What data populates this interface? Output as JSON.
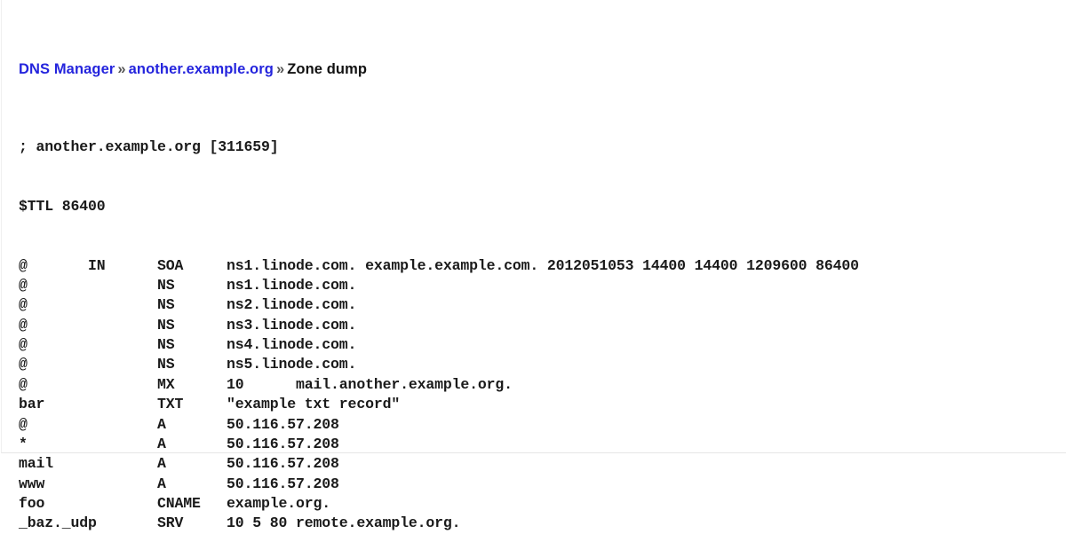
{
  "breadcrumb": {
    "root_label": "DNS Manager",
    "separator": "»",
    "zone_label": "another.example.org",
    "current_label": "Zone dump",
    "link_color": "#2424dd",
    "current_color": "#111111"
  },
  "zone_dump": {
    "comment_line": "; another.example.org [311659]",
    "ttl_line": "$TTL 86400",
    "zone_name": "another.example.org",
    "zone_id": "311659",
    "ttl": "86400",
    "columns": {
      "name": 8,
      "class": 8,
      "type": 8
    },
    "records": [
      {
        "name": "@",
        "class": "IN",
        "type": "SOA",
        "value": "ns1.linode.com. example.example.com. 2012051053 14400 14400 1209600 86400",
        "line": "@       IN      SOA     ns1.linode.com. example.example.com. 2012051053 14400 14400 1209600 86400"
      },
      {
        "name": "@",
        "class": "",
        "type": "NS",
        "value": "ns1.linode.com.",
        "line": "@               NS      ns1.linode.com."
      },
      {
        "name": "@",
        "class": "",
        "type": "NS",
        "value": "ns2.linode.com.",
        "line": "@               NS      ns2.linode.com."
      },
      {
        "name": "@",
        "class": "",
        "type": "NS",
        "value": "ns3.linode.com.",
        "line": "@               NS      ns3.linode.com."
      },
      {
        "name": "@",
        "class": "",
        "type": "NS",
        "value": "ns4.linode.com.",
        "line": "@               NS      ns4.linode.com."
      },
      {
        "name": "@",
        "class": "",
        "type": "NS",
        "value": "ns5.linode.com.",
        "line": "@               NS      ns5.linode.com."
      },
      {
        "name": "@",
        "class": "",
        "type": "MX",
        "value": "10      mail.another.example.org.",
        "line": "@               MX      10      mail.another.example.org."
      },
      {
        "name": "bar",
        "class": "",
        "type": "TXT",
        "value": "\"example txt record\"",
        "line": "bar             TXT     \"example txt record\""
      },
      {
        "name": "@",
        "class": "",
        "type": "A",
        "value": "50.116.57.208",
        "line": "@               A       50.116.57.208"
      },
      {
        "name": "*",
        "class": "",
        "type": "A",
        "value": "50.116.57.208",
        "line": "*               A       50.116.57.208"
      },
      {
        "name": "mail",
        "class": "",
        "type": "A",
        "value": "50.116.57.208",
        "line": "mail            A       50.116.57.208"
      },
      {
        "name": "www",
        "class": "",
        "type": "A",
        "value": "50.116.57.208",
        "line": "www             A       50.116.57.208"
      },
      {
        "name": "foo",
        "class": "",
        "type": "CNAME",
        "value": "example.org.",
        "line": "foo             CNAME   example.org."
      },
      {
        "name": "_baz._udp",
        "class": "",
        "type": "SRV",
        "value": "10 5 80 remote.example.org.",
        "line": "_baz._udp       SRV     10 5 80 remote.example.org."
      }
    ]
  }
}
